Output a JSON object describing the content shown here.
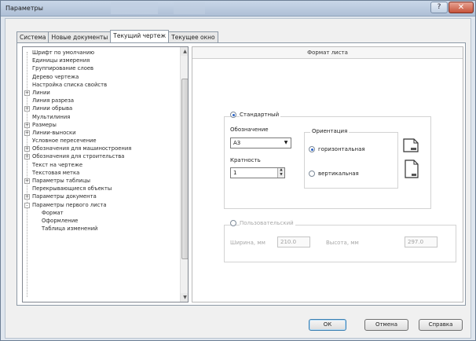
{
  "window": {
    "title": "Параметры",
    "help_glyph": "?",
    "close_glyph": "✕"
  },
  "tabs": [
    {
      "label": "Система",
      "active": false
    },
    {
      "label": "Новые документы",
      "active": false
    },
    {
      "label": "Текущий чертеж",
      "active": true
    },
    {
      "label": "Текущее окно",
      "active": false
    }
  ],
  "tree": {
    "items": [
      {
        "label": "Шрифт по умолчанию",
        "expander": ""
      },
      {
        "label": "Единицы измерения",
        "expander": ""
      },
      {
        "label": "Группирование слоев",
        "expander": ""
      },
      {
        "label": "Дерево чертежа",
        "expander": ""
      },
      {
        "label": "Настройка списка свойств",
        "expander": ""
      },
      {
        "label": "Линии",
        "expander": "+"
      },
      {
        "label": "Линия разреза",
        "expander": ""
      },
      {
        "label": "Линии обрыва",
        "expander": "+"
      },
      {
        "label": "Мультилиния",
        "expander": ""
      },
      {
        "label": "Размеры",
        "expander": "+"
      },
      {
        "label": "Линии-выноски",
        "expander": "+"
      },
      {
        "label": "Условное пересечение",
        "expander": ""
      },
      {
        "label": "Обозначения для машиностроения",
        "expander": "+"
      },
      {
        "label": "Обозначения для строительства",
        "expander": "+"
      },
      {
        "label": "Текст на чертеже",
        "expander": ""
      },
      {
        "label": "Текстовая метка",
        "expander": ""
      },
      {
        "label": "Параметры таблицы",
        "expander": "+"
      },
      {
        "label": "Перекрывающиеся объекты",
        "expander": ""
      },
      {
        "label": "Параметры документа",
        "expander": "+"
      },
      {
        "label": "Параметры первого листа",
        "expander": "-"
      },
      {
        "label": "Формат",
        "expander": "",
        "level": 2
      },
      {
        "label": "Оформление",
        "expander": "",
        "level": 2
      },
      {
        "label": "Таблица изменений",
        "expander": "",
        "level": 2
      }
    ],
    "scroll_up": "▲",
    "scroll_down": "▼"
  },
  "format_pane": {
    "header": "Формат листа",
    "standard": {
      "label": "Стандартный",
      "selected": true,
      "designation_label": "Обозначение",
      "designation_value": "А3",
      "multiplicity_label": "Кратность",
      "multiplicity_value": "1",
      "orientation_label": "Ориентация",
      "orientation_horizontal": "горизонтальная",
      "orientation_vertical": "вертикальная",
      "orientation_selected": "горизонтальная"
    },
    "custom": {
      "label": "Пользовательский",
      "selected": false,
      "width_label": "Ширина, мм",
      "width_value": "210.0",
      "height_label": "Высота, мм",
      "height_value": "297.0"
    }
  },
  "buttons": {
    "ok": "ОК",
    "cancel": "Отмена",
    "help": "Справка"
  },
  "colors": {
    "accent": "#2b63c7",
    "titlebar": "#aebfd6",
    "close": "#c6533a"
  }
}
